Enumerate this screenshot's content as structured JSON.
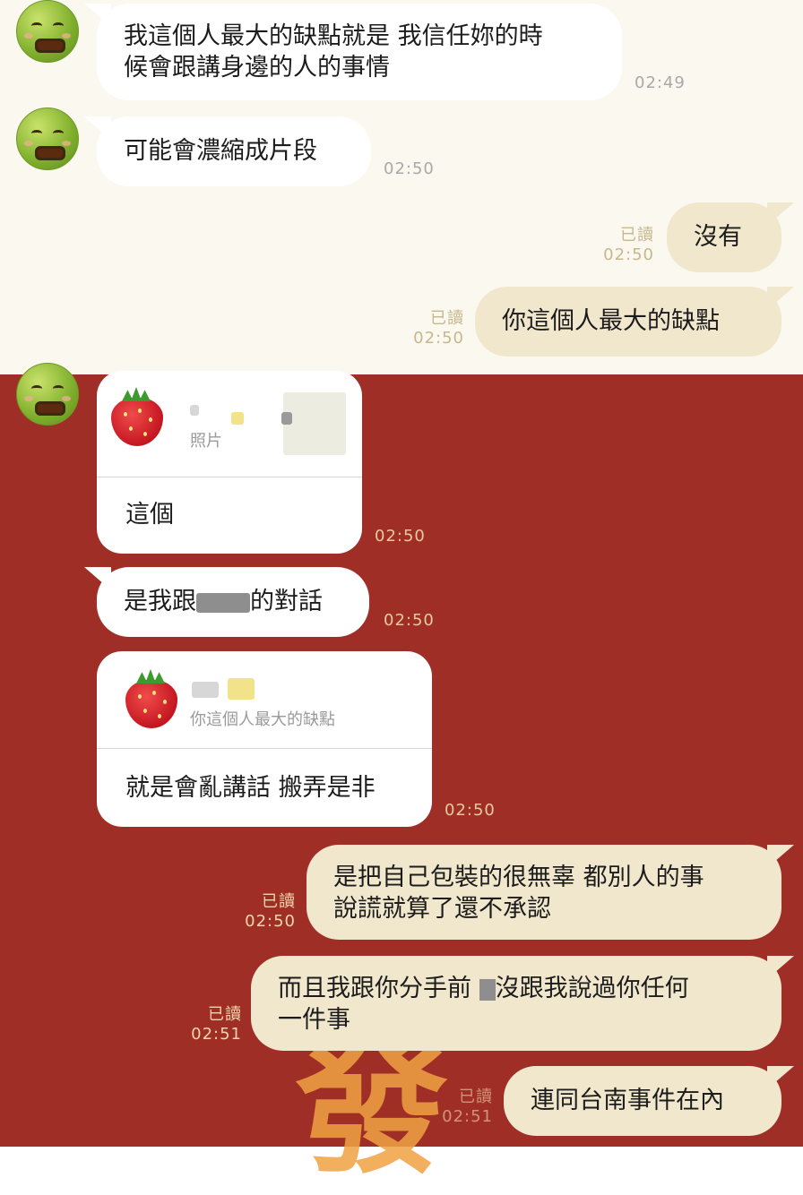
{
  "colors": {
    "top_bg": "#fbf8ef",
    "bottom_bg": "#9f2f26",
    "incoming_bubble": "#ffffff",
    "outgoing_bubble": "#f1e7cd"
  },
  "avatar_icon": "nauseated-face-icon",
  "messages": [
    {
      "side": "in",
      "text": "我這個人最大的缺點就是 我信任妳的時\n候會跟講身邊的人的事情",
      "time": "02:49"
    },
    {
      "side": "in",
      "text": "可能會濃縮成片段",
      "time": "02:50"
    },
    {
      "side": "out",
      "read": "已讀",
      "text": "沒有",
      "time": "02:50"
    },
    {
      "side": "out",
      "read": "已讀",
      "text": "你這個人最大的缺點",
      "time": "02:50"
    },
    {
      "side": "in",
      "quote": {
        "icon": "strawberry-icon",
        "caption": "照片"
      },
      "text": "這個",
      "time": "02:50"
    },
    {
      "side": "in",
      "text_a": "是我跟",
      "text_b": "的對話",
      "time": "02:50"
    },
    {
      "side": "in",
      "quote": {
        "icon": "strawberry-icon",
        "caption": "你這個人最大的缺點"
      },
      "text": "就是會亂講話 搬弄是非",
      "time": "02:50"
    },
    {
      "side": "out",
      "read": "已讀",
      "text": "是把自己包裝的很無辜 都別人的事\n說謊就算了還不承認",
      "time": "02:50"
    },
    {
      "side": "out",
      "read": "已讀",
      "text_a": "而且我跟你分手前 ",
      "text_b": "沒跟我說過你任何\n一件事",
      "time": "02:51"
    },
    {
      "side": "out",
      "read": "已讀",
      "text": "連同台南事件在內",
      "time": "02:51"
    }
  ],
  "decoration": "發"
}
